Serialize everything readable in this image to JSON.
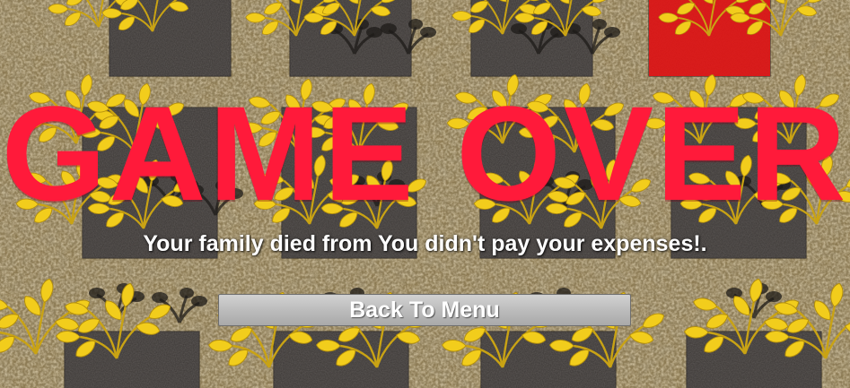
{
  "game_over": {
    "title": "GAME OVER",
    "message": "Your family died from You didn't pay your expenses!.",
    "back_button_label": "Back To Menu"
  },
  "colors": {
    "title": "#ff1a3a",
    "message": "#ffffff",
    "button": "#bebebe",
    "soil": "#3a3634",
    "wheat": "#f2cd1c",
    "ground": "#8c7a52"
  },
  "icons": {
    "crop": "wheat-crop-icon",
    "plot": "soil-plot",
    "highlight": "selected-plot-highlight"
  }
}
